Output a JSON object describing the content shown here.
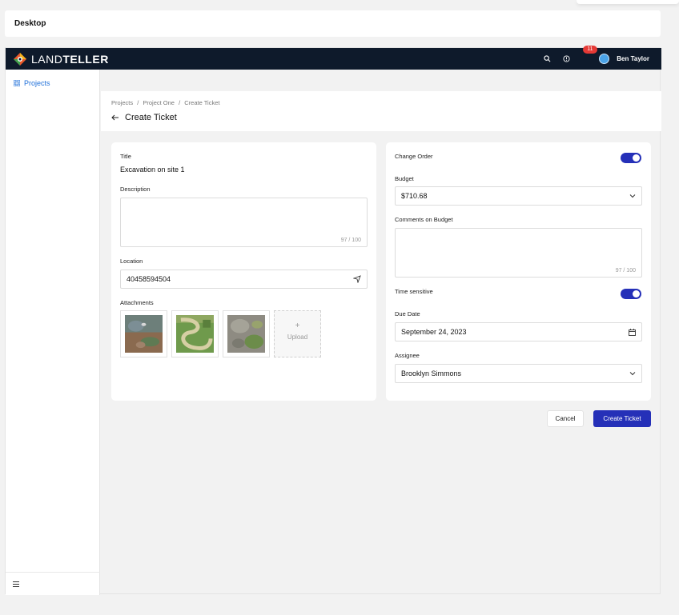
{
  "frame": {
    "title": "Desktop"
  },
  "navbar": {
    "brand_thin": "LAND",
    "brand_bold": "TELLER",
    "notification_count": "11",
    "user_name": "Ben Taylor"
  },
  "sidebar": {
    "items": [
      {
        "label": "Projects",
        "icon": "grid-icon"
      }
    ],
    "bottom_icon": "hamburger-menu-icon"
  },
  "header": {
    "breadcrumb": [
      "Projects",
      "/",
      "Project One",
      "/",
      "Create Ticket"
    ],
    "title": "Create Ticket"
  },
  "form_left": {
    "title_label": "Title",
    "title_value": "Excavation on site 1",
    "description_label": "Description",
    "description_counter": "97 / 100",
    "location_label": "Location",
    "location_value": "40458594504",
    "attachments_label": "Attachments",
    "upload_plus": "+",
    "upload_label": "Upload"
  },
  "form_right": {
    "change_order_label": "Change Order",
    "change_order_on": true,
    "budget_label": "Budget",
    "budget_value": "$710.68",
    "comments_label": "Comments on Budget",
    "comments_counter": "97 / 100",
    "time_sensitive_label": "Time sensitive",
    "time_sensitive_on": true,
    "due_date_label": "Due Date",
    "due_date_value": "September 24, 2023",
    "assignee_label": "Assignee",
    "assignee_value": "Brooklyn Simmons"
  },
  "actions": {
    "cancel_label": "Cancel",
    "create_label": "Create Ticket"
  },
  "colors": {
    "navbar": "#0e1a2b",
    "primary": "#2530b8",
    "link": "#1e6fd9",
    "badge": "#e53935"
  }
}
